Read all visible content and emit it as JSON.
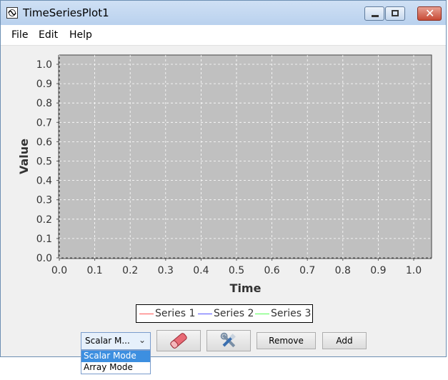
{
  "window": {
    "title": "TimeSeriesPlot1"
  },
  "menu": {
    "items": [
      "File",
      "Edit",
      "Help"
    ]
  },
  "chart_data": {
    "type": "line",
    "xlabel": "Time",
    "ylabel": "Value",
    "xlim": [
      0.0,
      1.0
    ],
    "ylim": [
      0.0,
      1.0
    ],
    "x_ticks": [
      "0.0",
      "0.1",
      "0.2",
      "0.3",
      "0.4",
      "0.5",
      "0.6",
      "0.7",
      "0.8",
      "0.9",
      "1.0"
    ],
    "y_ticks": [
      "0.0",
      "0.1",
      "0.2",
      "0.3",
      "0.4",
      "0.5",
      "0.6",
      "0.7",
      "0.8",
      "0.9",
      "1.0"
    ],
    "grid": true,
    "plot_background": "#c0c0c0",
    "legend_position": "bottom",
    "series": [
      {
        "name": "Series 1",
        "color": "#ff5555",
        "values": []
      },
      {
        "name": "Series 2",
        "color": "#5555ff",
        "values": []
      },
      {
        "name": "Series 3",
        "color": "#55ff55",
        "values": []
      }
    ]
  },
  "controls": {
    "mode_combo": {
      "value": "Scalar M...",
      "options": [
        "Scalar Mode",
        "Array Mode"
      ]
    },
    "clear_button_icon": "eraser-icon",
    "settings_button_icon": "tools-icon",
    "remove_label": "Remove",
    "add_label": "Add"
  }
}
